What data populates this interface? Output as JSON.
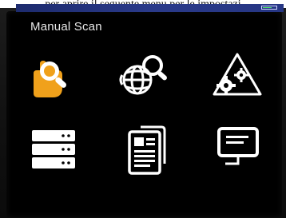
{
  "caption": "per aprire il seguente menu per le impostazi",
  "screen": {
    "title": "Manual Scan",
    "battery_level": 0.7
  },
  "menu": {
    "items": [
      {
        "icon": "manual-scan-icon",
        "selected": true
      },
      {
        "icon": "internet-search-icon",
        "selected": false
      },
      {
        "icon": "network-settings-icon",
        "selected": false
      },
      {
        "icon": "server-list-icon",
        "selected": false
      },
      {
        "icon": "document-icon",
        "selected": false
      },
      {
        "icon": "monitor-icon",
        "selected": false
      }
    ]
  },
  "colors": {
    "accent": "#f0a11b",
    "icon": "#ffffff",
    "status_bar": "#26357f",
    "screen_bg": "#000000"
  }
}
